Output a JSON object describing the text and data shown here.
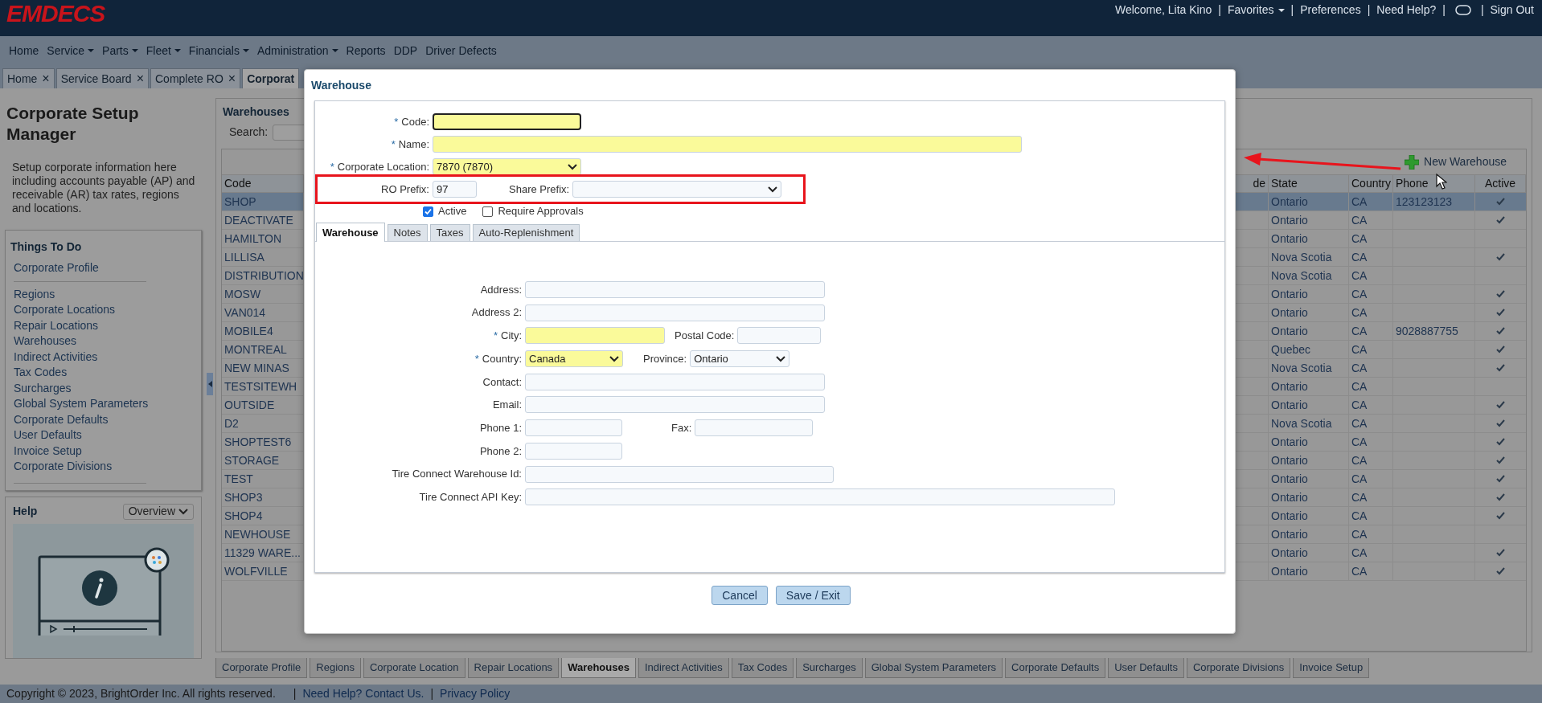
{
  "header": {
    "logo": "EMDECS",
    "user_links": [
      {
        "kind": "text",
        "text": "Welcome, Lita Kino"
      },
      {
        "kind": "separator",
        "text": "|"
      },
      {
        "kind": "menu",
        "text": "Favorites"
      },
      {
        "kind": "separator",
        "text": "|"
      },
      {
        "kind": "link",
        "text": "Preferences"
      },
      {
        "kind": "separator",
        "text": "|"
      },
      {
        "kind": "link",
        "text": "Need Help?"
      },
      {
        "kind": "separator",
        "text": "|"
      },
      {
        "kind": "icon"
      },
      {
        "kind": "separator",
        "text": "|"
      },
      {
        "kind": "link",
        "text": "Sign Out"
      }
    ]
  },
  "nav_menu": [
    {
      "label": "Home",
      "dropdown": false
    },
    {
      "label": "Service",
      "dropdown": true
    },
    {
      "label": "Parts",
      "dropdown": true
    },
    {
      "label": "Fleet",
      "dropdown": true
    },
    {
      "label": "Financials",
      "dropdown": true
    },
    {
      "label": "Administration",
      "dropdown": true
    },
    {
      "label": "Reports",
      "dropdown": false
    },
    {
      "label": "DDP",
      "dropdown": false
    },
    {
      "label": "Driver Defects",
      "dropdown": false
    }
  ],
  "page_tabs": [
    {
      "label": "Home",
      "close": "×",
      "selected": false
    },
    {
      "label": "Service Board",
      "close": "×",
      "selected": false
    },
    {
      "label": "Complete RO",
      "close": "×",
      "selected": false
    },
    {
      "label": "Corporat",
      "selected": true
    }
  ],
  "sidebar": {
    "title": "Corporate Setup Manager",
    "description": "Setup corporate information here including accounts payable (AP) and receivable (AR) tax rates, regions and locations.",
    "things_to_do": {
      "title": "Things To Do",
      "groups": [
        [
          "Corporate Profile"
        ],
        [
          "Regions",
          "Corporate Locations",
          "Repair Locations",
          "Warehouses",
          "Indirect Activities",
          "Tax Codes",
          "Surcharges",
          "Global System Parameters",
          "Corporate Defaults",
          "User Defaults",
          "Invoice Setup",
          "Corporate Divisions"
        ]
      ]
    },
    "help": {
      "title": "Help",
      "dropdown": "Overview"
    }
  },
  "warehouses_panel": {
    "title": "Warehouses",
    "search_label": "Search:",
    "new_button": "New Warehouse",
    "columns": [
      "Code",
      "de",
      "State",
      "Country",
      "Phone",
      "Active"
    ],
    "rows": [
      {
        "code": "SHOP",
        "state": "Ontario",
        "country": "CA",
        "phone": "123123123",
        "active": true,
        "selected": true
      },
      {
        "code": "DEACTIVATE",
        "state": "Ontario",
        "country": "CA",
        "active": true,
        "selected": false
      },
      {
        "code": "HAMILTON",
        "state": "Ontario",
        "country": "CA",
        "active": false,
        "selected": false
      },
      {
        "code": "LILLISA",
        "state": "Nova Scotia",
        "country": "CA",
        "active": true,
        "selected": false
      },
      {
        "code": "DISTRIBUTION",
        "state": "Nova Scotia",
        "country": "CA",
        "active": false,
        "selected": false
      },
      {
        "code": "MOSW",
        "state": "Ontario",
        "country": "CA",
        "active": true,
        "selected": false
      },
      {
        "code": "VAN014",
        "state": "Ontario",
        "country": "CA",
        "active": true,
        "selected": false
      },
      {
        "code": "MOBILE4",
        "state": "Ontario",
        "country": "CA",
        "phone": "9028887755",
        "active": true,
        "selected": false
      },
      {
        "code": "MONTREAL",
        "state": "Quebec",
        "country": "CA",
        "active": true,
        "selected": false
      },
      {
        "code": "NEW MINAS",
        "state": "Nova Scotia",
        "country": "CA",
        "active": true,
        "selected": false
      },
      {
        "code": "TESTSITEWH",
        "state": "Ontario",
        "country": "CA",
        "active": false,
        "selected": false
      },
      {
        "code": "OUTSIDE",
        "state": "Ontario",
        "country": "CA",
        "active": true,
        "selected": false
      },
      {
        "code": "D2",
        "state": "Nova Scotia",
        "country": "CA",
        "active": true,
        "selected": false
      },
      {
        "code": "SHOPTEST6",
        "state": "Ontario",
        "country": "CA",
        "active": true,
        "selected": false
      },
      {
        "code": "STORAGE",
        "state": "Ontario",
        "country": "CA",
        "active": true,
        "selected": false
      },
      {
        "code": "TEST",
        "state": "Ontario",
        "country": "CA",
        "active": true,
        "selected": false
      },
      {
        "code": "SHOP3",
        "state": "Ontario",
        "country": "CA",
        "active": true,
        "selected": false
      },
      {
        "code": "SHOP4",
        "state": "Ontario",
        "country": "CA",
        "active": true,
        "selected": false
      },
      {
        "code": "NEWHOUSE",
        "state": "Ontario",
        "country": "CA",
        "active": false,
        "selected": false
      },
      {
        "code": "11329 WARE...",
        "state": "Ontario",
        "country": "CA",
        "active": true,
        "selected": false
      },
      {
        "code": "WOLFVILLE",
        "state": "Ontario",
        "country": "CA",
        "active": true,
        "selected": false
      }
    ]
  },
  "bottom_tabs": [
    {
      "label": "Corporate Profile",
      "selected": false
    },
    {
      "label": "Regions",
      "selected": false
    },
    {
      "label": "Corporate Location",
      "selected": false
    },
    {
      "label": "Repair Locations",
      "selected": false
    },
    {
      "label": "Warehouses",
      "selected": true
    },
    {
      "label": "Indirect Activities",
      "selected": false
    },
    {
      "label": "Tax Codes",
      "selected": false
    },
    {
      "label": "Surcharges",
      "selected": false
    },
    {
      "label": "Global System Parameters",
      "selected": false
    },
    {
      "label": "Corporate Defaults",
      "selected": false
    },
    {
      "label": "User Defaults",
      "selected": false
    },
    {
      "label": "Corporate Divisions",
      "selected": false
    },
    {
      "label": "Invoice Setup",
      "selected": false
    }
  ],
  "footer": [
    {
      "kind": "text",
      "text": "Copyright © 2023, BrightOrder Inc. All rights reserved."
    },
    {
      "kind": "separator",
      "text": "|"
    },
    {
      "kind": "link",
      "text": "Need Help? Contact Us."
    },
    {
      "kind": "separator",
      "text": "|"
    },
    {
      "kind": "link",
      "text": "Privacy Policy"
    }
  ],
  "dialog": {
    "title": "Warehouse",
    "top_rows": [
      [
        {
          "kind": "input",
          "marker": "*",
          "label": "Code:",
          "required": true,
          "focused": true
        }
      ],
      [
        {
          "kind": "input",
          "marker": "*",
          "label": "Name:",
          "required": true,
          "focused": false
        }
      ],
      [
        {
          "kind": "select",
          "marker": "*",
          "label": "Corporate Location:",
          "value": "7870 (7870)",
          "required": true,
          "focused": false
        }
      ],
      [
        {
          "kind": "input",
          "label": "RO Prefix:",
          "value": "97",
          "required": false,
          "focused": false
        },
        {
          "kind": "select",
          "label": "Share Prefix:",
          "required": false,
          "focused": false
        }
      ]
    ],
    "checkboxes": [
      {
        "label": "Active",
        "checked": true
      },
      {
        "label": "Require Approvals",
        "checked": false
      }
    ],
    "tabs": [
      {
        "label": "Warehouse",
        "selected": true
      },
      {
        "label": "Notes",
        "selected": false
      },
      {
        "label": "Taxes",
        "selected": false
      },
      {
        "label": "Auto-Replenishment",
        "selected": false
      }
    ],
    "tab_rows": [
      [
        {
          "kind": "input",
          "label": "Address:",
          "required": false,
          "focused": false
        }
      ],
      [
        {
          "kind": "input",
          "label": "Address 2:",
          "required": false,
          "focused": false
        }
      ],
      [
        {
          "kind": "input",
          "marker": "*",
          "label": "City:",
          "required": true,
          "focused": false
        },
        {
          "kind": "input",
          "label": "Postal Code:",
          "required": false,
          "focused": false
        }
      ],
      [
        {
          "kind": "select",
          "marker": "*",
          "label": "Country:",
          "value": "Canada",
          "required": true,
          "focused": false
        },
        {
          "kind": "select",
          "label": "Province:",
          "value": "Ontario",
          "required": false,
          "focused": false
        }
      ],
      [
        {
          "kind": "input",
          "label": "Contact:",
          "required": false,
          "focused": false
        }
      ],
      [
        {
          "kind": "input",
          "label": "Email:",
          "required": false,
          "focused": false
        }
      ],
      [
        {
          "kind": "input",
          "label": "Phone 1:",
          "required": false,
          "focused": false
        },
        {
          "kind": "input",
          "label": "Fax:",
          "required": false,
          "focused": false
        }
      ],
      [
        {
          "kind": "input",
          "label": "Phone 2:",
          "required": false,
          "focused": false
        }
      ],
      [
        {
          "kind": "input",
          "label": "Tire Connect Warehouse Id:",
          "required": false,
          "focused": false
        }
      ],
      [
        {
          "kind": "input",
          "label": "Tire Connect API Key:",
          "required": false,
          "focused": false
        }
      ]
    ],
    "buttons": [
      "Cancel",
      "Save / Exit"
    ]
  }
}
